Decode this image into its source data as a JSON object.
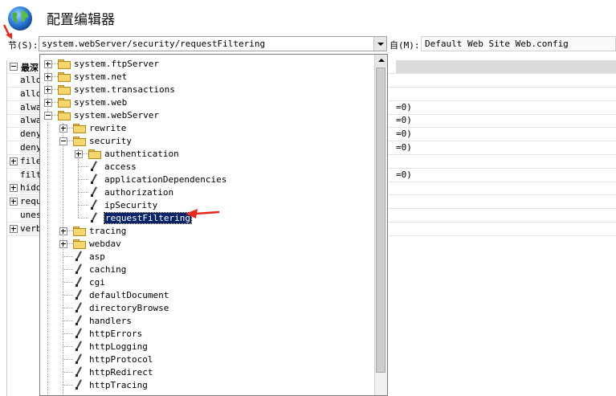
{
  "header": {
    "title": "配置编辑器",
    "globe_icon": "globe-icon"
  },
  "section": {
    "label": "节(S):",
    "value": "system.webServer/security/requestFiltering"
  },
  "from": {
    "label": "自(M):",
    "value": "Default Web Site Web.config"
  },
  "grid": {
    "group_title": "最深",
    "rows": [
      {
        "name": "allo",
        "expand": "",
        "value": ""
      },
      {
        "name": "allo",
        "expand": "",
        "value": ""
      },
      {
        "name": "alwa",
        "expand": "",
        "value": "=0)"
      },
      {
        "name": "alwa",
        "expand": "",
        "value": "=0)"
      },
      {
        "name": "deny",
        "expand": "",
        "value": "=0)"
      },
      {
        "name": "deny",
        "expand": "",
        "value": "=0)"
      },
      {
        "name": "file",
        "expand": "plus",
        "value": ""
      },
      {
        "name": "filt",
        "expand": "",
        "value": "=0)"
      },
      {
        "name": "hidd",
        "expand": "plus",
        "value": ""
      },
      {
        "name": "requ",
        "expand": "plus",
        "value": ""
      },
      {
        "name": "unes",
        "expand": "",
        "value": ""
      },
      {
        "name": "verb",
        "expand": "plus",
        "value": ""
      }
    ]
  },
  "tree": [
    {
      "label": "system.ftpServer",
      "level": 0,
      "type": "folder",
      "expand": "plus"
    },
    {
      "label": "system.net",
      "level": 0,
      "type": "folder",
      "expand": "plus"
    },
    {
      "label": "system.transactions",
      "level": 0,
      "type": "folder",
      "expand": "plus"
    },
    {
      "label": "system.web",
      "level": 0,
      "type": "folder",
      "expand": "plus"
    },
    {
      "label": "system.webServer",
      "level": 0,
      "type": "folder",
      "expand": "minus"
    },
    {
      "label": "rewrite",
      "level": 1,
      "type": "folder",
      "expand": "plus"
    },
    {
      "label": "security",
      "level": 1,
      "type": "folder",
      "expand": "minus"
    },
    {
      "label": "authentication",
      "level": 2,
      "type": "folder",
      "expand": "plus"
    },
    {
      "label": "access",
      "level": 2,
      "type": "leaf",
      "expand": ""
    },
    {
      "label": "applicationDependencies",
      "level": 2,
      "type": "leaf",
      "expand": ""
    },
    {
      "label": "authorization",
      "level": 2,
      "type": "leaf",
      "expand": ""
    },
    {
      "label": "ipSecurity",
      "level": 2,
      "type": "leaf",
      "expand": ""
    },
    {
      "label": "requestFiltering",
      "level": 2,
      "type": "leaf",
      "expand": "",
      "selected": true
    },
    {
      "label": "tracing",
      "level": 1,
      "type": "folder",
      "expand": "plus"
    },
    {
      "label": "webdav",
      "level": 1,
      "type": "folder",
      "expand": "plus"
    },
    {
      "label": "asp",
      "level": 1,
      "type": "leaf",
      "expand": ""
    },
    {
      "label": "caching",
      "level": 1,
      "type": "leaf",
      "expand": ""
    },
    {
      "label": "cgi",
      "level": 1,
      "type": "leaf",
      "expand": ""
    },
    {
      "label": "defaultDocument",
      "level": 1,
      "type": "leaf",
      "expand": ""
    },
    {
      "label": "directoryBrowse",
      "level": 1,
      "type": "leaf",
      "expand": ""
    },
    {
      "label": "handlers",
      "level": 1,
      "type": "leaf",
      "expand": ""
    },
    {
      "label": "httpErrors",
      "level": 1,
      "type": "leaf",
      "expand": ""
    },
    {
      "label": "httpLogging",
      "level": 1,
      "type": "leaf",
      "expand": ""
    },
    {
      "label": "httpProtocol",
      "level": 1,
      "type": "leaf",
      "expand": ""
    },
    {
      "label": "httpRedirect",
      "level": 1,
      "type": "leaf",
      "expand": ""
    },
    {
      "label": "httpTracing",
      "level": 1,
      "type": "leaf",
      "expand": ""
    }
  ],
  "colors": {
    "selection": "#0a246a",
    "annotation_arrow": "#e8281e",
    "folder": "#f5d66c"
  }
}
